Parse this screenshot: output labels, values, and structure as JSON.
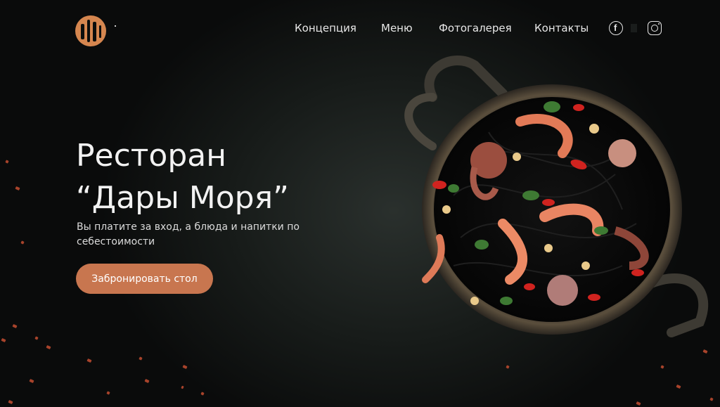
{
  "header": {
    "logo_icon": "restaurant-logo-icon",
    "nav": [
      {
        "label": "Концепция"
      },
      {
        "label": "Меню"
      },
      {
        "label": "Фотогалерея"
      },
      {
        "label": "Контакты"
      }
    ],
    "social": [
      {
        "icon": "facebook-icon"
      },
      {
        "icon": "instagram-icon"
      }
    ]
  },
  "hero": {
    "title_line1": "Ресторан",
    "title_line2": "“Дары Моря”",
    "subtitle": "Вы платите за вход, а блюда и напитки по себестоимости",
    "cta_label": "Забронировать стол"
  },
  "colors": {
    "accent": "#c8764f",
    "logo": "#d5864f",
    "background": "#0b0d0c"
  }
}
